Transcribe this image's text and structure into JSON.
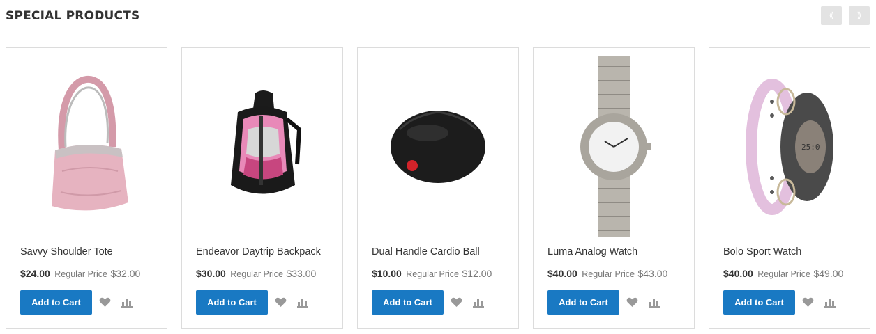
{
  "section": {
    "title": "Special Products",
    "prev_label": "⟪",
    "next_label": "⟫"
  },
  "icons": {
    "wishlist": "heart-icon",
    "compare": "compare-bar-chart-icon",
    "icon_color": "#999999"
  },
  "colors": {
    "primary_button": "#1979c3",
    "nav_button": "#e3e3e3"
  },
  "products": [
    {
      "name": "Savvy Shoulder Tote",
      "special_price": "$24.00",
      "regular_label": "Regular Price",
      "regular_price": "$32.00",
      "add_to_cart": "Add to Cart",
      "image": "pink-shoulder-bag"
    },
    {
      "name": "Endeavor Daytrip Backpack",
      "special_price": "$30.00",
      "regular_label": "Regular Price",
      "regular_price": "$33.00",
      "add_to_cart": "Add to Cart",
      "image": "pink-black-backpack"
    },
    {
      "name": "Dual Handle Cardio Ball",
      "special_price": "$10.00",
      "regular_label": "Regular Price",
      "regular_price": "$12.00",
      "add_to_cart": "Add to Cart",
      "image": "black-cardio-ball"
    },
    {
      "name": "Luma Analog Watch",
      "special_price": "$40.00",
      "regular_label": "Regular Price",
      "regular_price": "$43.00",
      "add_to_cart": "Add to Cart",
      "image": "silver-analog-watch"
    },
    {
      "name": "Bolo Sport Watch",
      "special_price": "$40.00",
      "regular_label": "Regular Price",
      "regular_price": "$49.00",
      "add_to_cart": "Add to Cart",
      "image": "pink-black-sport-watch"
    }
  ]
}
